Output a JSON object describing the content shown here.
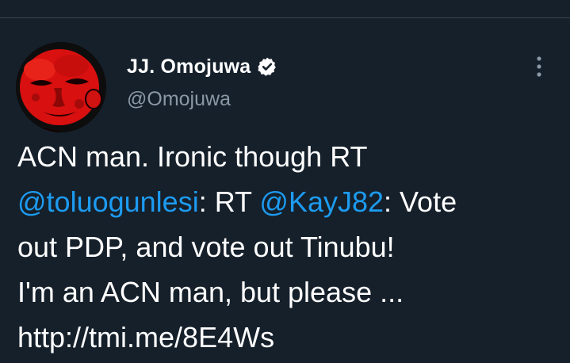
{
  "tweet": {
    "author": {
      "name": "JJ. Omojuwa",
      "handle": "@Omojuwa",
      "verified": true,
      "avatar_icon": "avatar-photo"
    },
    "more_icon": "more-vertical-icon",
    "text": {
      "line1": "ACN man. Ironic though  RT",
      "mention1": "@toluogunlesi",
      "line2_mid": ": RT ",
      "mention2": "@KayJ82",
      "line2_end": ": Vote",
      "line3": "out PDP, and vote out Tinubu!",
      "line4": "I'm an ACN man, but please ...",
      "line5": "http://tmi.me/8E4Ws"
    }
  },
  "colors": {
    "background": "#15202b",
    "primary_text": "#ffffff",
    "secondary_text": "#8b98a5",
    "link": "#1d9bf0",
    "divider": "#38444d"
  }
}
